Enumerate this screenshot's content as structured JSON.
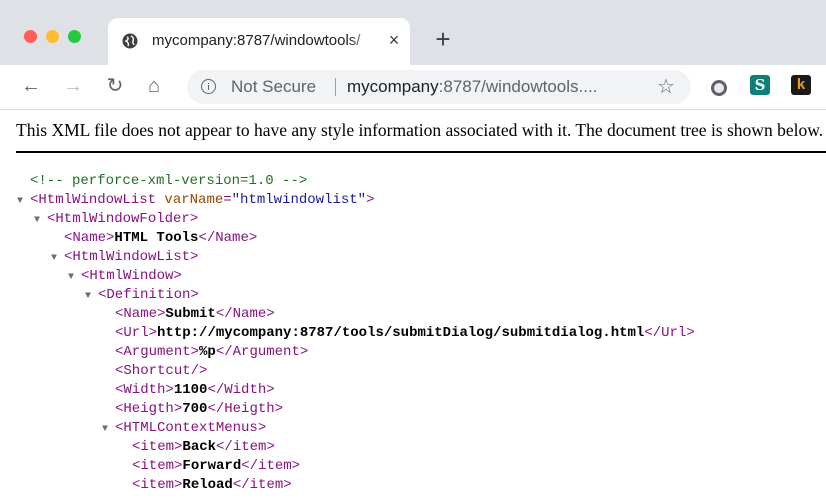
{
  "browser": {
    "tab": {
      "title": "mycompany:8787/windowtools/",
      "close_glyph": "×"
    },
    "new_tab_glyph": "+",
    "nav": {
      "back": "←",
      "forward": "→",
      "reload": "↻",
      "home": "⌂",
      "star": "☆"
    },
    "omnibox": {
      "security_label": "Not Secure",
      "url_host": "mycompany",
      "url_rest": ":8787/windowtools...."
    },
    "extensions": [
      {
        "name": "circle-extension-icon"
      },
      {
        "name": "s-extension-icon",
        "letter": "S"
      },
      {
        "name": "k-extension-icon",
        "letter": "k"
      }
    ],
    "traffic_lights": {
      "close": "#fe5f57",
      "minimize": "#febc2e",
      "zoom": "#28c840"
    }
  },
  "page": {
    "notice": "This XML file does not appear to have any style information associated with it. The document tree is shown below.",
    "xml_lines": [
      {
        "collapse": "",
        "open": "",
        "name": "",
        "attr": "",
        "eq": "",
        "val": "",
        "close": "",
        "text": "",
        "end": "",
        "comment": "<!-- perforce-xml-version=1.0 -->"
      },
      {
        "collapse": "▼",
        "open": "<",
        "name": "HtmlWindowList",
        "attr": " varName",
        "eq": "=",
        "val": "\"htmlwindowlist\"",
        "close": ">",
        "text": "",
        "end": "",
        "comment": ""
      },
      {
        "collapse": "▼",
        "open": "<",
        "name": "HtmlWindowFolder",
        "attr": "",
        "eq": "",
        "val": "",
        "close": ">",
        "text": "",
        "end": "",
        "comment": ""
      },
      {
        "collapse": "",
        "open": "<",
        "name": "Name",
        "attr": "",
        "eq": "",
        "val": "",
        "close": ">",
        "text": "HTML Tools",
        "end": "</Name>",
        "comment": ""
      },
      {
        "collapse": "▼",
        "open": "<",
        "name": "HtmlWindowList",
        "attr": "",
        "eq": "",
        "val": "",
        "close": ">",
        "text": "",
        "end": "",
        "comment": ""
      },
      {
        "collapse": "▼",
        "open": "<",
        "name": "HtmlWindow",
        "attr": "",
        "eq": "",
        "val": "",
        "close": ">",
        "text": "",
        "end": "",
        "comment": ""
      },
      {
        "collapse": "▼",
        "open": "<",
        "name": "Definition",
        "attr": "",
        "eq": "",
        "val": "",
        "close": ">",
        "text": "",
        "end": "",
        "comment": ""
      },
      {
        "collapse": "",
        "open": "<",
        "name": "Name",
        "attr": "",
        "eq": "",
        "val": "",
        "close": ">",
        "text": "Submit",
        "end": "</Name>",
        "comment": ""
      },
      {
        "collapse": "",
        "open": "<",
        "name": "Url",
        "attr": "",
        "eq": "",
        "val": "",
        "close": ">",
        "text": "http://mycompany:8787/tools/submitDialog/submitdialog.html",
        "end": "</Url>",
        "comment": ""
      },
      {
        "collapse": "",
        "open": "<",
        "name": "Argument",
        "attr": "",
        "eq": "",
        "val": "",
        "close": ">",
        "text": "%p",
        "end": "</Argument>",
        "comment": ""
      },
      {
        "collapse": "",
        "open": "<",
        "name": "Shortcut",
        "attr": "",
        "eq": "",
        "val": "",
        "close": "/>",
        "text": "",
        "end": "",
        "comment": ""
      },
      {
        "collapse": "",
        "open": "<",
        "name": "Width",
        "attr": "",
        "eq": "",
        "val": "",
        "close": ">",
        "text": "1100",
        "end": "</Width>",
        "comment": ""
      },
      {
        "collapse": "",
        "open": "<",
        "name": "Heigth",
        "attr": "",
        "eq": "",
        "val": "",
        "close": ">",
        "text": "700",
        "end": "</Heigth>",
        "comment": ""
      },
      {
        "collapse": "▼",
        "open": "<",
        "name": "HTMLContextMenus",
        "attr": "",
        "eq": "",
        "val": "",
        "close": ">",
        "text": "",
        "end": "",
        "comment": ""
      },
      {
        "collapse": "",
        "open": "<",
        "name": "item",
        "attr": "",
        "eq": "",
        "val": "",
        "close": ">",
        "text": "Back",
        "end": "</item>",
        "comment": ""
      },
      {
        "collapse": "",
        "open": "<",
        "name": "item",
        "attr": "",
        "eq": "",
        "val": "",
        "close": ">",
        "text": "Forward",
        "end": "</item>",
        "comment": ""
      },
      {
        "collapse": "",
        "open": "<",
        "name": "item",
        "attr": "",
        "eq": "",
        "val": "",
        "close": ">",
        "text": "Reload",
        "end": "</item>",
        "comment": ""
      }
    ]
  },
  "colors": {
    "tag": "#881280",
    "attr": "#994500",
    "value": "#1a1aa6",
    "comment": "#236e25",
    "tabstrip": "#dee1e6"
  }
}
